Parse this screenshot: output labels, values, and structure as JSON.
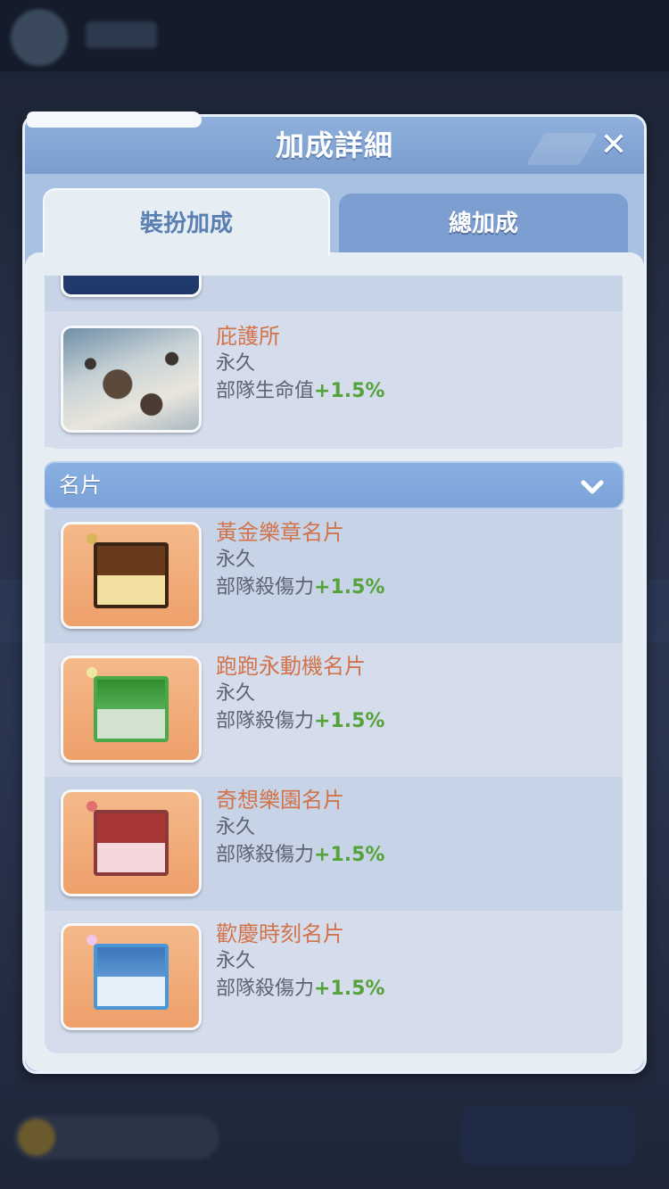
{
  "dialog": {
    "title": "加成詳細",
    "close_glyph": "✕"
  },
  "tabs": [
    {
      "label": "裝扮加成",
      "active": true
    },
    {
      "label": "總加成",
      "active": false
    }
  ],
  "shelter_item": {
    "name": "庇護所",
    "duration": "永久",
    "effect_label": "部隊生命值",
    "effect_value": "+1.5%"
  },
  "namecard_section": {
    "label": "名片",
    "items": [
      {
        "name": "黃金樂章名片",
        "duration": "永久",
        "effect_label": "部隊殺傷力",
        "effect_value": "+1.5%"
      },
      {
        "name": "跑跑永動機名片",
        "duration": "永久",
        "effect_label": "部隊殺傷力",
        "effect_value": "+1.5%"
      },
      {
        "name": "奇想樂園名片",
        "duration": "永久",
        "effect_label": "部隊殺傷力",
        "effect_value": "+1.5%"
      },
      {
        "name": "歡慶時刻名片",
        "duration": "永久",
        "effect_label": "部隊殺傷力",
        "effect_value": "+1.5%"
      }
    ]
  },
  "colors": {
    "item_name": "#d2734a",
    "bonus_green": "#56a23a",
    "header_blue": "#7aa2d8"
  }
}
